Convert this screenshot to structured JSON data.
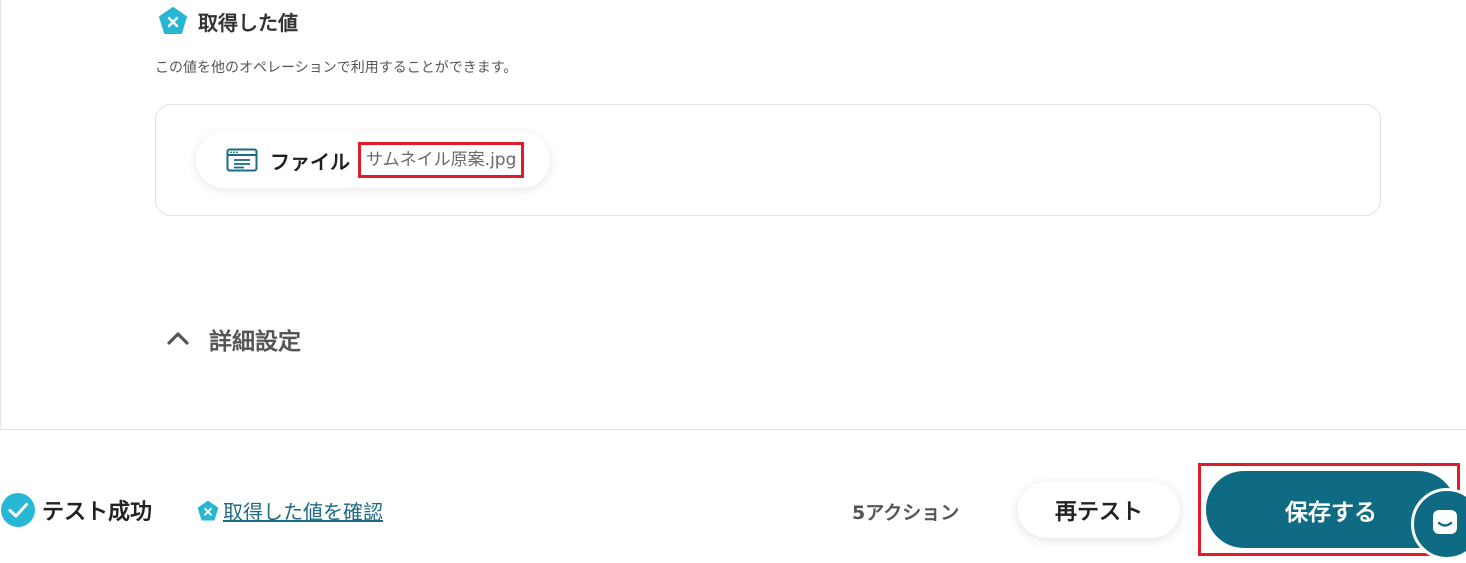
{
  "output_section": {
    "title": "取得した値",
    "description": "この値を他のオペレーションで利用することができます。",
    "icon": "pentagon-x-icon",
    "values": [
      {
        "label": "ファイル",
        "value": "サムネイル原案.jpg",
        "icon": "file-window-icon"
      }
    ]
  },
  "advanced": {
    "label": "詳細設定",
    "icon": "chevron-up-icon"
  },
  "footer": {
    "status_label": "テスト成功",
    "view_values_label": "取得した値を確認",
    "action_count": "5アクション",
    "retest_label": "再テスト",
    "save_label": "保存する"
  },
  "colors": {
    "accent": "#0e6b83",
    "success": "#27b6d4",
    "highlight": "#e01b2a",
    "link": "#1d6b85"
  }
}
